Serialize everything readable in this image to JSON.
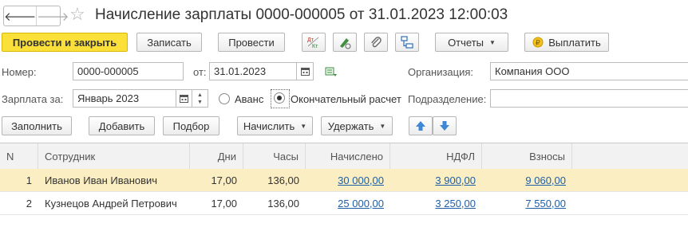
{
  "window": {
    "title": "Начисление зарплаты 0000-000005 от 31.01.2023 12:00:03"
  },
  "toolbar": {
    "post_and_close": "Провести и закрыть",
    "save": "Записать",
    "post": "Провести",
    "reports": "Отчеты",
    "pay": "Выплатить"
  },
  "form": {
    "number_label": "Номер:",
    "number_value": "0000-000005",
    "date_label": "от:",
    "date_value": "31.01.2023",
    "org_label": "Организация:",
    "org_value": "Компания ООО",
    "salary_for_label": "Зарплата за:",
    "salary_for_value": "Январь 2023",
    "advance_label": "Аванс",
    "final_label": "Окончательный расчет",
    "final_selected": true,
    "division_label": "Подразделение:",
    "division_value": ""
  },
  "table_toolbar": {
    "fill": "Заполнить",
    "add": "Добавить",
    "pick": "Подбор",
    "accrue": "Начислить",
    "withhold": "Удержать"
  },
  "table": {
    "columns": [
      "N",
      "Сотрудник",
      "Дни",
      "Часы",
      "Начислено",
      "НДФЛ",
      "Взносы"
    ],
    "rows": [
      {
        "n": "1",
        "employee": "Иванов Иван Иванович",
        "days": "17,00",
        "hours": "136,00",
        "accrued": "30 000,00",
        "ndfl": "3 900,00",
        "contrib": "9 060,00",
        "selected": true
      },
      {
        "n": "2",
        "employee": "Кузнецов Андрей Петрович",
        "days": "17,00",
        "hours": "136,00",
        "accrued": "25 000,00",
        "ndfl": "3 250,00",
        "contrib": "7 550,00",
        "selected": false
      }
    ]
  },
  "icons": {
    "back": "arrow-left-icon",
    "forward": "arrow-right-icon",
    "favorite": "star-icon",
    "dt_kt": "dt-kt-icon",
    "sign": "sign-icon",
    "attach": "paperclip-icon",
    "structure": "structure-icon",
    "coin": "coin-icon",
    "up": "arrow-up-icon",
    "down": "arrow-down-icon"
  },
  "colors": {
    "primary_button": "#fbe03a",
    "selected_row": "#fbeec2",
    "link": "#1f5fa8",
    "move_arrows": "#3d87d6"
  }
}
